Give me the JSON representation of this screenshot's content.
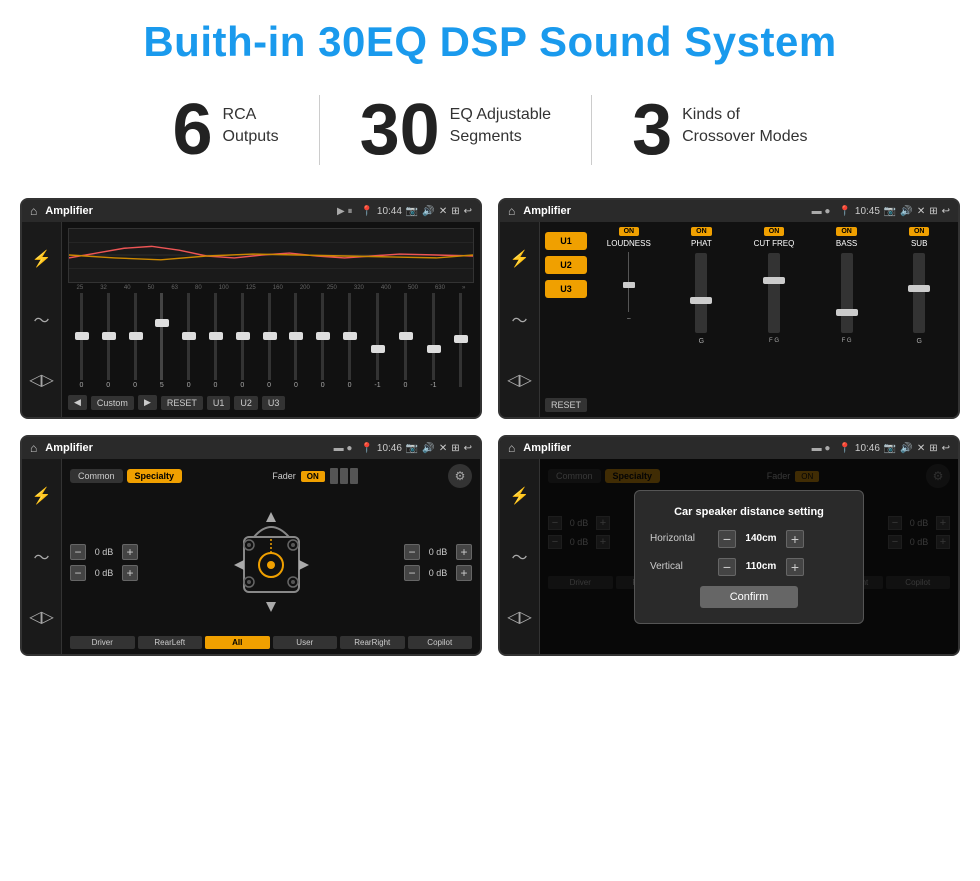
{
  "header": {
    "title": "Buith-in 30EQ DSP Sound System"
  },
  "stats": [
    {
      "number": "6",
      "line1": "RCA",
      "line2": "Outputs"
    },
    {
      "number": "30",
      "line1": "EQ Adjustable",
      "line2": "Segments"
    },
    {
      "number": "3",
      "line1": "Kinds of",
      "line2": "Crossover Modes"
    }
  ],
  "screens": [
    {
      "id": "screen1",
      "topbar": {
        "title": "Amplifier",
        "time": "10:44"
      },
      "type": "eq"
    },
    {
      "id": "screen2",
      "topbar": {
        "title": "Amplifier",
        "time": "10:45"
      },
      "type": "amp2"
    },
    {
      "id": "screen3",
      "topbar": {
        "title": "Amplifier",
        "time": "10:46"
      },
      "type": "fader"
    },
    {
      "id": "screen4",
      "topbar": {
        "title": "Amplifier",
        "time": "10:46"
      },
      "type": "fader-dialog"
    }
  ],
  "eq": {
    "freqs": [
      "25",
      "32",
      "40",
      "50",
      "63",
      "80",
      "100",
      "125",
      "160",
      "200",
      "250",
      "320",
      "400",
      "500",
      "630"
    ],
    "values": [
      "0",
      "0",
      "0",
      "5",
      "0",
      "0",
      "0",
      "0",
      "0",
      "0",
      "0",
      "-1",
      "0",
      "-1",
      ""
    ],
    "buttons": [
      "Custom",
      "RESET",
      "U1",
      "U2",
      "U3"
    ]
  },
  "amp2": {
    "presets": [
      "U1",
      "U2",
      "U3"
    ],
    "channels": [
      {
        "label": "LOUDNESS",
        "on": true
      },
      {
        "label": "PHAT",
        "on": true
      },
      {
        "label": "CUT FREQ",
        "on": true
      },
      {
        "label": "BASS",
        "on": true
      },
      {
        "label": "SUB",
        "on": true
      }
    ],
    "reset": "RESET"
  },
  "fader": {
    "tabs": [
      "Common",
      "Specialty"
    ],
    "active_tab": "Specialty",
    "fader_label": "Fader",
    "on": "ON",
    "db_values": [
      "0 dB",
      "0 dB",
      "0 dB",
      "0 dB"
    ],
    "buttons": [
      "Driver",
      "RearLeft",
      "All",
      "User",
      "RearRight",
      "Copilot"
    ]
  },
  "dialog": {
    "title": "Car speaker distance setting",
    "horizontal_label": "Horizontal",
    "horizontal_value": "140cm",
    "vertical_label": "Vertical",
    "vertical_value": "110cm",
    "confirm": "Confirm"
  }
}
